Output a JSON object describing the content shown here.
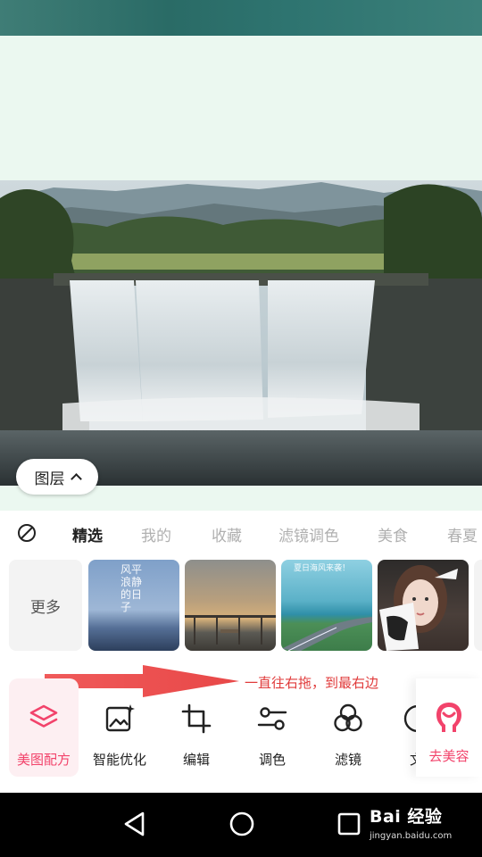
{
  "layer_button": {
    "label": "图层"
  },
  "filter_tabs": [
    "精选",
    "我的",
    "收藏",
    "滤镜调色",
    "美食",
    "春夏"
  ],
  "active_tab": "精选",
  "filter_strip": {
    "more_label": "更多",
    "thumb1_text": "风平浪静的日子",
    "thumb3_text": "夏日海风来袭！"
  },
  "annotation": {
    "text": "一直往右拖，到最右边"
  },
  "tools": [
    {
      "label": "美图配方",
      "icon": "layers-icon",
      "active": true
    },
    {
      "label": "智能优化",
      "icon": "magic-image-icon"
    },
    {
      "label": "编辑",
      "icon": "crop-icon"
    },
    {
      "label": "调色",
      "icon": "sliders-icon"
    },
    {
      "label": "滤镜",
      "icon": "filter-circles-icon"
    },
    {
      "label": "文",
      "icon": "text-icon"
    }
  ],
  "go_beauty": {
    "label": "去美容",
    "icon": "face-beauty-icon"
  },
  "watermark": {
    "brand": "Bai 经验",
    "url": "jingyan.baidu.com"
  },
  "colors": {
    "accent": "#f2436b",
    "annotation": "#e03a3a",
    "bg_tint": "#ebf8f0"
  }
}
